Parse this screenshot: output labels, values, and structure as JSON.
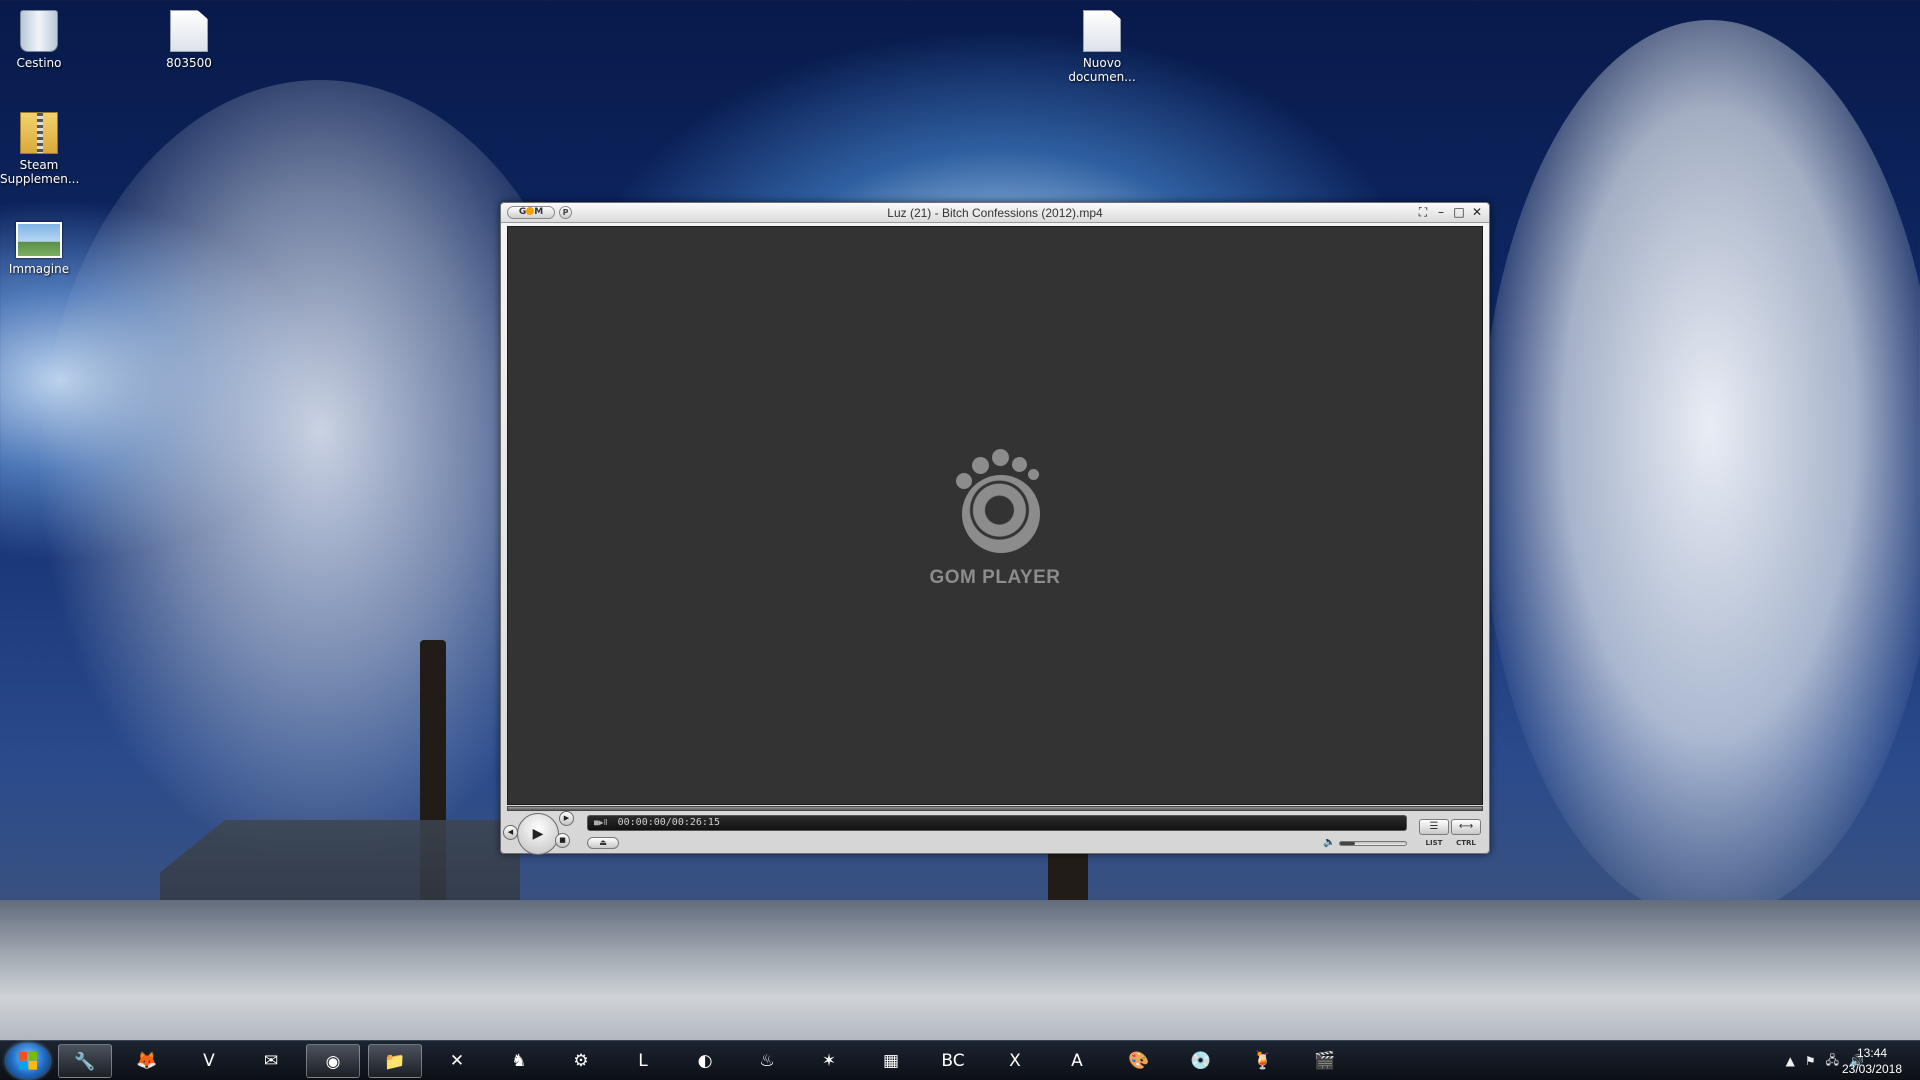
{
  "desktop": {
    "icons": [
      {
        "label": "Cestino",
        "icon": "recycle-bin-icon"
      },
      {
        "label": "803500",
        "icon": "file-icon"
      },
      {
        "label": "Steam Supplemen...",
        "icon": "zip-folder-icon"
      },
      {
        "label": "Immagine",
        "icon": "image-file-icon"
      },
      {
        "label": "Nuovo documen...",
        "icon": "text-file-icon"
      }
    ]
  },
  "gom": {
    "title": "Luz (21) - Bitch Confessions (2012).mp4",
    "logo_button": "G",
    "pref_button": "P",
    "brand": "GOM PLAYER",
    "time_display": "00:00:00/00:26:15",
    "list_label": "LIST",
    "ctrl_label": "CTRL",
    "win_controls": {
      "fullscreen": "⛶",
      "minimize": "–",
      "maximize": "□",
      "close": "✕"
    }
  },
  "taskbar": {
    "apps": [
      {
        "icon": "toolbox-icon",
        "glyph": "🔧",
        "active": true
      },
      {
        "icon": "firefox-icon",
        "glyph": "🦊",
        "active": false
      },
      {
        "icon": "vivaldi-icon",
        "glyph": "V",
        "active": false
      },
      {
        "icon": "thunderbird-icon",
        "glyph": "✉",
        "active": false
      },
      {
        "icon": "gom-player-icon",
        "glyph": "◉",
        "active": true
      },
      {
        "icon": "file-explorer-icon",
        "glyph": "📁",
        "active": true
      },
      {
        "icon": "x-app-icon",
        "glyph": "✕",
        "active": false
      },
      {
        "icon": "game-icon",
        "glyph": "♞",
        "active": false
      },
      {
        "icon": "steam-client-icon",
        "glyph": "⚙",
        "active": false
      },
      {
        "icon": "league-icon",
        "glyph": "L",
        "active": false
      },
      {
        "icon": "origin-icon",
        "glyph": "◐",
        "active": false
      },
      {
        "icon": "steam-icon",
        "glyph": "♨",
        "active": false
      },
      {
        "icon": "battlenet-icon",
        "glyph": "✶",
        "active": false
      },
      {
        "icon": "archive-icon",
        "glyph": "▦",
        "active": false
      },
      {
        "icon": "bc-icon",
        "glyph": "BC",
        "active": false
      },
      {
        "icon": "excel-icon",
        "glyph": "X",
        "active": false
      },
      {
        "icon": "acrobat-icon",
        "glyph": "A",
        "active": false
      },
      {
        "icon": "paint-icon",
        "glyph": "🎨",
        "active": false
      },
      {
        "icon": "disc-burner-icon",
        "glyph": "💿",
        "active": false
      },
      {
        "icon": "cocktail-icon",
        "glyph": "🍹",
        "active": false
      },
      {
        "icon": "clapper-icon",
        "glyph": "🎬",
        "active": false
      }
    ],
    "clock_time": "13:44",
    "clock_date": "23/03/2018"
  },
  "colors": {
    "video_bg": "#333333",
    "brand_gray": "#8c8c8c",
    "taskbar": "#0c1016"
  }
}
